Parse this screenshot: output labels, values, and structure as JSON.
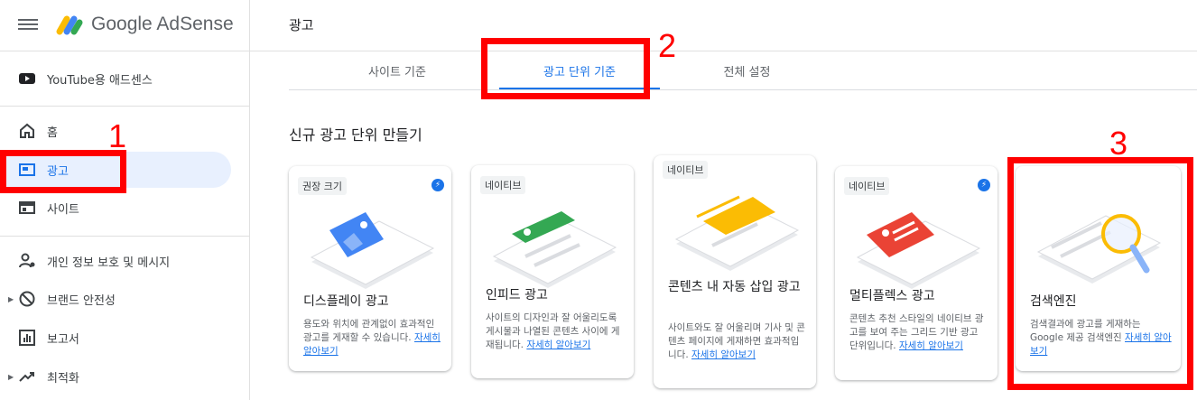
{
  "app": {
    "name": "Google AdSense",
    "page_title": "광고"
  },
  "sidebar": {
    "items": [
      {
        "label": "YouTube용 애드센스"
      },
      {
        "label": "홈"
      },
      {
        "label": "광고"
      },
      {
        "label": "사이트"
      },
      {
        "label": "개인 정보 보호 및 메시지"
      },
      {
        "label": "브랜드 안전성"
      },
      {
        "label": "보고서"
      },
      {
        "label": "최적화"
      }
    ]
  },
  "tabs": [
    {
      "label": "사이트 기준"
    },
    {
      "label": "광고 단위 기준"
    },
    {
      "label": "전체 설정"
    }
  ],
  "section_title": "신규 광고 단위 만들기",
  "cards": [
    {
      "badge": "권장 크기",
      "title": "디스플레이 광고",
      "desc": "용도와 위치에 관계없이 효과적인 광고를 게재할 수 있습니다.",
      "link": "자세히 알아보기"
    },
    {
      "badge": "네이티브",
      "title": "인피드 광고",
      "desc": "사이트의 디자인과 잘 어울리도록 게시물과 나열된 콘텐츠 사이에 게재됩니다.",
      "link": "자세히 알아보기"
    },
    {
      "badge": "네이티브",
      "title": "콘텐츠 내 자동 삽입 광고",
      "desc": "사이트와도 잘 어울리며 기사 및 콘텐츠 페이지에 게재하면 효과적입니다.",
      "link": "자세히 알아보기"
    },
    {
      "badge": "네이티브",
      "title": "멀티플렉스 광고",
      "desc": "콘텐츠 추천 스타일의 네이티브 광고를 보여 주는 그리드 기반 광고 단위입니다.",
      "link": "자세히 알아보기"
    },
    {
      "badge": "",
      "title": "검색엔진",
      "desc": "검색결과에 광고를 게재하는 Google 제공 검색엔진",
      "link": "자세히 알아보기"
    }
  ],
  "annotations": [
    "1",
    "2",
    "3"
  ],
  "colors": {
    "accent": "#1a73e8",
    "annotation": "#ff0000",
    "active_bg": "#e8f0fe"
  }
}
